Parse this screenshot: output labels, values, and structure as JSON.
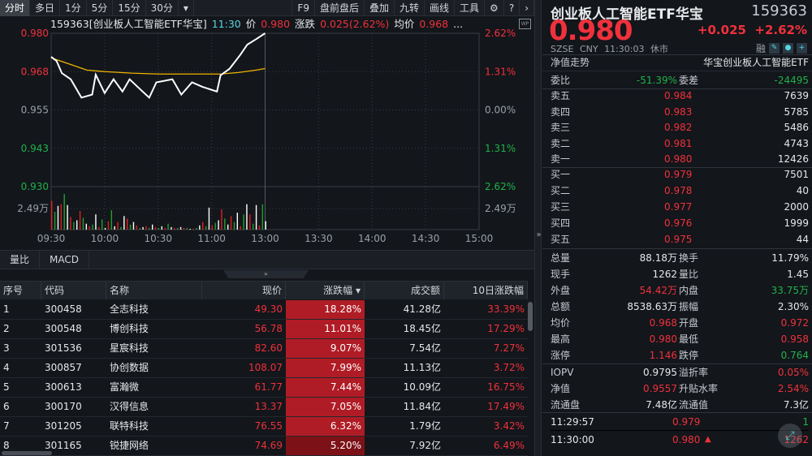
{
  "toolbar": {
    "left": [
      "分时",
      "多日",
      "1分",
      "5分",
      "15分",
      "30分",
      "▾"
    ],
    "right": [
      "F9",
      "盘前盘后",
      "叠加",
      "九转",
      "画线",
      "工具",
      "⚙",
      "?",
      "›"
    ]
  },
  "info": {
    "code_name": "159363[创业板人工智能ETF华宝]",
    "time": "11:30",
    "price_label": "价",
    "price": "0.980",
    "change_label": "涨跌",
    "change": "0.025(2.62%)",
    "avg_label": "均价",
    "avg": "0.968",
    "more": "...",
    "wp": "WP"
  },
  "chart_data": {
    "type": "line",
    "title": "159363[创业板人工智能ETF华宝]",
    "y_left_ticks": [
      "0.980",
      "0.968",
      "0.955",
      "0.943",
      "0.930"
    ],
    "y_right_ticks": [
      "2.62%",
      "1.31%",
      "0.00%",
      "1.31%",
      "2.62%"
    ],
    "volume_tick": "2.49万",
    "x_ticks": [
      "09:30",
      "10:00",
      "10:30",
      "11:00",
      "13:00",
      "13:30",
      "14:00",
      "14:30",
      "15:00"
    ],
    "ylim": [
      0.93,
      0.98
    ],
    "prev_close": 0.955,
    "price_series": {
      "name": "价",
      "minutes": [
        0,
        3,
        6,
        11,
        17,
        23,
        25,
        30,
        35,
        40,
        44,
        50,
        55,
        59,
        68,
        73,
        79,
        85,
        93,
        95,
        100,
        106,
        110,
        115,
        120
      ],
      "values": [
        0.9723,
        0.971,
        0.967,
        0.965,
        0.959,
        0.96,
        0.9665,
        0.9605,
        0.965,
        0.961,
        0.965,
        0.9617,
        0.959,
        0.964,
        0.965,
        0.96,
        0.964,
        0.9625,
        0.961,
        0.9663,
        0.9684,
        0.9729,
        0.9763,
        0.9781,
        0.98
      ]
    },
    "avg_series": {
      "name": "均价",
      "minutes": [
        0,
        10,
        20,
        30,
        45,
        60,
        80,
        95,
        105,
        115,
        120
      ],
      "values": [
        0.972,
        0.97,
        0.968,
        0.9675,
        0.967,
        0.9667,
        0.9667,
        0.9667,
        0.9672,
        0.968,
        0.9685
      ]
    },
    "volume": {
      "unit": "万",
      "values": [
        3.4,
        2.1,
        2.8,
        3.0,
        4.2,
        2.9,
        1.5,
        0.9,
        1.1,
        2.2,
        1.4,
        0.7,
        0.4,
        0.6,
        1.8,
        0.3,
        1.2,
        0.2,
        1.0,
        2.3,
        0.4,
        0.9,
        0.3,
        1.6,
        1.3,
        0.6,
        0.9,
        0.5,
        0.2,
        0.3,
        0.4,
        0.2,
        0.6,
        0.3,
        0.2,
        0.4,
        0.2,
        0.7,
        0.3,
        0.2,
        0.2,
        0.3,
        0.2,
        0.2,
        0.1,
        0.1,
        0.2,
        0.5,
        0.9,
        0.4,
        2.6,
        0.5,
        0.8,
        1.1,
        2.4,
        1.3,
        0.6,
        1.6,
        0.9,
        2.0,
        0.4,
        1.8,
        3.0,
        1.8,
        0.7,
        2.9,
        0.5,
        3.0,
        1.0
      ]
    }
  },
  "tabs": [
    "量比",
    "MACD"
  ],
  "collapse": "»",
  "table": {
    "headers": [
      "序号",
      "代码",
      "名称",
      "现价",
      "涨跌幅 ▾",
      "成交额",
      "10日涨跌幅"
    ],
    "rows": [
      [
        "1",
        "300458",
        "全志科技",
        "49.30",
        "18.28%",
        "41.28亿",
        "33.39%"
      ],
      [
        "2",
        "300548",
        "博创科技",
        "56.78",
        "11.01%",
        "18.45亿",
        "17.29%"
      ],
      [
        "3",
        "301536",
        "星宸科技",
        "82.60",
        "9.07%",
        "7.54亿",
        "7.27%"
      ],
      [
        "4",
        "300857",
        "协创数据",
        "108.07",
        "7.99%",
        "11.13亿",
        "3.72%"
      ],
      [
        "5",
        "300613",
        "富瀚微",
        "61.77",
        "7.44%",
        "10.09亿",
        "16.75%"
      ],
      [
        "6",
        "300170",
        "汉得信息",
        "13.37",
        "7.05%",
        "11.84亿",
        "17.49%"
      ],
      [
        "7",
        "301205",
        "联特科技",
        "76.55",
        "6.32%",
        "1.79亿",
        "3.42%"
      ],
      [
        "8",
        "301165",
        "锐捷网络",
        "74.69",
        "5.20%",
        "7.92亿",
        "6.49%"
      ]
    ]
  },
  "divider": "»",
  "quote": {
    "title": "创业板人工智能ETF华宝",
    "code": "159363",
    "price": "0.980",
    "change": "+0.025",
    "change_pct": "+2.62%",
    "exchange": "SZSE",
    "currency": "CNY",
    "time": "11:30:03",
    "status": "休市",
    "margin": "融",
    "nav_trend": "净值走势",
    "fund_name": "华宝创业板人工智能ETF",
    "wb_label": "委比",
    "wb": "-51.39%",
    "wc_label": "委差",
    "wc": "-24495",
    "sells": [
      [
        "卖五",
        "0.984",
        "7639"
      ],
      [
        "卖四",
        "0.983",
        "5785"
      ],
      [
        "卖三",
        "0.982",
        "5486"
      ],
      [
        "卖二",
        "0.981",
        "4743"
      ],
      [
        "卖一",
        "0.980",
        "12426"
      ]
    ],
    "buys": [
      [
        "买一",
        "0.979",
        "7501"
      ],
      [
        "买二",
        "0.978",
        "40"
      ],
      [
        "买三",
        "0.977",
        "2000"
      ],
      [
        "买四",
        "0.976",
        "1999"
      ],
      [
        "买五",
        "0.975",
        "44"
      ]
    ],
    "stats": [
      [
        "总量",
        "88.18万",
        "换手",
        "11.79%"
      ],
      [
        "现手",
        "1262",
        "量比",
        "1.45"
      ],
      [
        "外盘",
        "54.42万",
        "内盘",
        "33.75万"
      ],
      [
        "总额",
        "8538.63万",
        "振幅",
        "2.30%"
      ],
      [
        "均价",
        "0.968",
        "开盘",
        "0.972"
      ],
      [
        "最高",
        "0.980",
        "最低",
        "0.958"
      ],
      [
        "涨停",
        "1.146",
        "跌停",
        "0.764"
      ]
    ],
    "fund": [
      [
        "IOPV",
        "0.9795",
        "溢折率",
        "0.05%"
      ],
      [
        "净值",
        "0.9557",
        "升贴水率",
        "2.54%"
      ],
      [
        "流通盘",
        "7.48亿",
        "流通值",
        "7.3亿"
      ]
    ],
    "ticks": [
      [
        "11:29:57",
        "0.979",
        "1"
      ],
      [
        "11:30:00",
        "0.980",
        "1262"
      ]
    ],
    "up_arrow": "🡅"
  },
  "colors": {
    "up": "#f0313b",
    "down": "#20b24a",
    "avg": "#f0b400",
    "bg": "#13161b"
  }
}
